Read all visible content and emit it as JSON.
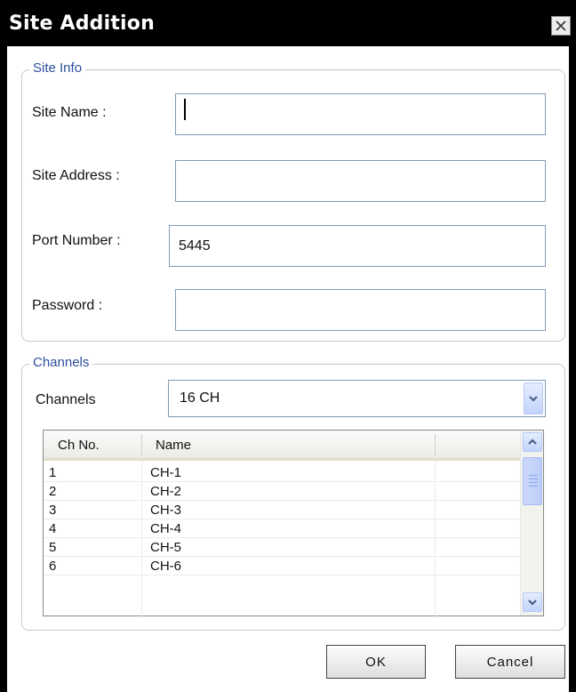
{
  "window": {
    "title": "Site Addition"
  },
  "site_info": {
    "legend": "Site Info",
    "fields": [
      {
        "label": "Site Name :",
        "value": ""
      },
      {
        "label": "Site Address :",
        "value": ""
      },
      {
        "label": "Port Number :",
        "value": "5445"
      },
      {
        "label": "Password :",
        "value": ""
      }
    ]
  },
  "channels": {
    "legend": "Channels",
    "label": "Channels",
    "selected": "16 CH",
    "table": {
      "columns": [
        "Ch No.",
        "Name"
      ],
      "rows": [
        {
          "no": "1",
          "name": "CH-1"
        },
        {
          "no": "2",
          "name": "CH-2"
        },
        {
          "no": "3",
          "name": "CH-3"
        },
        {
          "no": "4",
          "name": "CH-4"
        },
        {
          "no": "5",
          "name": "CH-5"
        },
        {
          "no": "6",
          "name": "CH-6"
        }
      ]
    }
  },
  "buttons": {
    "ok": "OK",
    "cancel": "Cancel"
  },
  "icons": {
    "close": "close-icon",
    "dropdown": "chevron-down-icon",
    "scroll_up": "arrow-up-icon",
    "scroll_down": "arrow-down-icon"
  },
  "colors": {
    "titlebar": "#000000",
    "legend": "#2a4f9c",
    "input_border": "#7f9db9",
    "scroll_accent": "#c3d3fd"
  }
}
